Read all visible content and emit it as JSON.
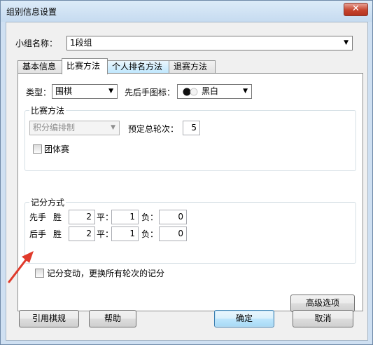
{
  "window": {
    "title": "组别信息设置",
    "close_symbol": "✕"
  },
  "group_name": {
    "label": "小组名称：",
    "value": "1段组"
  },
  "tabs": [
    {
      "label": "基本信息"
    },
    {
      "label": "比赛方法"
    },
    {
      "label": "个人排名方法"
    },
    {
      "label": "退赛方法"
    }
  ],
  "match": {
    "type_label": "类型：",
    "type_value": "围棋",
    "icon_label": "先后手图标：",
    "icon_value": "黑白",
    "icon_name": "black-white-stones-icon"
  },
  "method_group": {
    "title": "比赛方法",
    "method_value": "积分编排制",
    "rounds_label": "预定总轮次：",
    "rounds_value": "5",
    "team_label": "团体赛",
    "team_checked": false
  },
  "scoring": {
    "title": "记分方式",
    "win_label": "胜",
    "draw_label": "平：",
    "loss_label": "负：",
    "rows": [
      {
        "side": "先手",
        "win": "2",
        "draw": "1",
        "loss": "0"
      },
      {
        "side": "后手",
        "win": "2",
        "draw": "1",
        "loss": "0"
      }
    ]
  },
  "change_score": {
    "label": "记分变动，更换所有轮次的记分",
    "checked": false
  },
  "buttons": {
    "advanced": "高级选项",
    "cite_rules": "引用棋规",
    "help": "帮助",
    "ok": "确定",
    "cancel": "取消"
  },
  "colors": {
    "annotation_arrow": "#e03a2b",
    "window_frame": "#cfe0f2"
  }
}
